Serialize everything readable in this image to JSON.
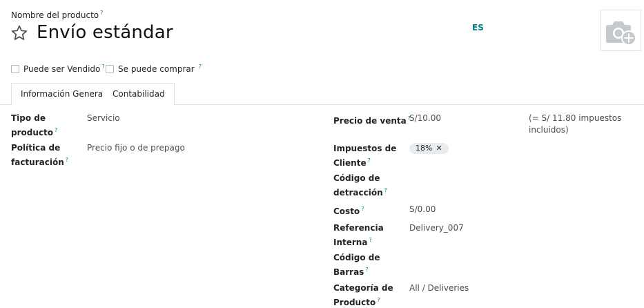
{
  "header": {
    "name_label": "Nombre del producto",
    "help_mark": "?",
    "product_name": "Envío estándar",
    "language": "ES"
  },
  "checkboxes": [
    {
      "label": "Puede ser Vendido",
      "checked": false
    },
    {
      "label": "Se puede comprar",
      "checked": false
    }
  ],
  "tabs": [
    {
      "label": "Información General",
      "active": true
    },
    {
      "label": "Contabilidad",
      "active": false
    }
  ],
  "left_fields": {
    "product_type": {
      "label_1": "Tipo de",
      "label_2": "producto",
      "value": "Servicio"
    },
    "invoice_policy": {
      "label_1": "Política de",
      "label_2": "facturación",
      "value": "Precio fijo o de prepago"
    }
  },
  "right_fields": {
    "sale_price": {
      "label": "Precio de venta",
      "value": "S/10.00",
      "note_1": "(= S/ 11.80 impuestos",
      "note_2": "incluidos)"
    },
    "customer_taxes": {
      "label_1": "Impuestos de",
      "label_2": "Cliente",
      "tag": "18%",
      "tag_remove": "✕"
    },
    "detraction_code": {
      "label_1": "Código de",
      "label_2": "detracción"
    },
    "cost": {
      "label": "Costo",
      "value": "S/0.00"
    },
    "internal_ref": {
      "label_1": "Referencia",
      "label_2": "Interna",
      "value": "Delivery_007"
    },
    "barcode": {
      "label_1": "Código de",
      "label_2": "Barras"
    },
    "category": {
      "label_1": "Categoría de",
      "label_2": "Producto",
      "value": "All / Deliveries"
    }
  },
  "icons": {
    "star": "star-outline-icon",
    "photo": "camera-add-icon"
  },
  "colors": {
    "accent": "#017e84",
    "border": "#dee2e6",
    "tag_bg": "#e9ecef"
  }
}
